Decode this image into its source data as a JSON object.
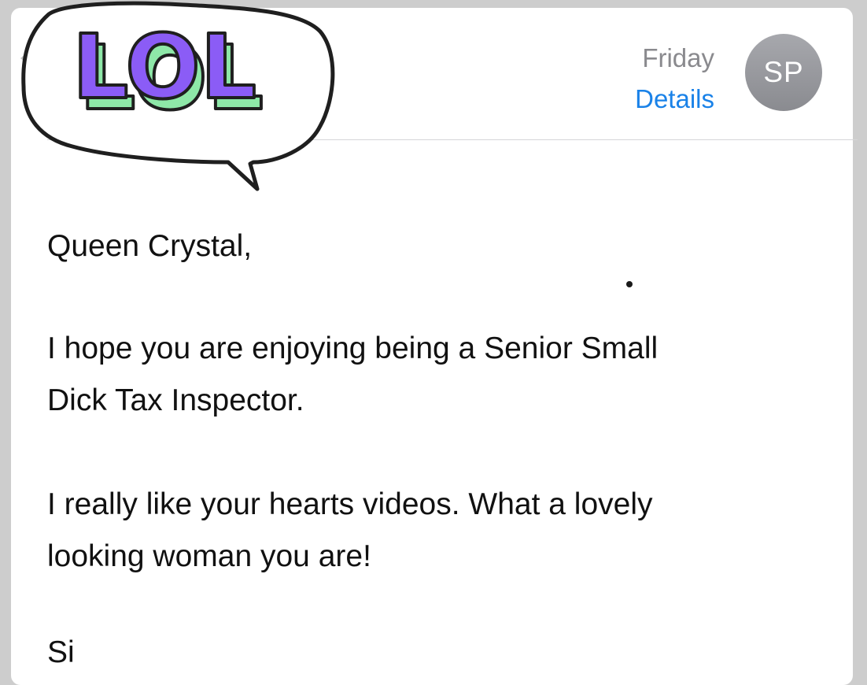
{
  "header": {
    "date": "Friday",
    "details_label": "Details",
    "avatar_initials": "SP"
  },
  "sticker": {
    "text": "LOL",
    "colors": {
      "letter_face": "#8b5cf6",
      "letter_side": "#8ee8a8",
      "outline": "#1f1f1f"
    }
  },
  "message": {
    "greeting": "Queen Crystal,",
    "paragraph1_line1": "I hope you are enjoying being a Senior Small",
    "paragraph1_line2": "Dick Tax Inspector.",
    "paragraph2_line1": "I really like your hearts videos. What a lovely",
    "paragraph2_line2": "looking woman you are!",
    "cut_off_line": "Si"
  },
  "colors": {
    "link": "#1a82e8",
    "muted": "#8a8a8e",
    "avatar": "#9a9ba0",
    "background": "#cdcdcd"
  }
}
